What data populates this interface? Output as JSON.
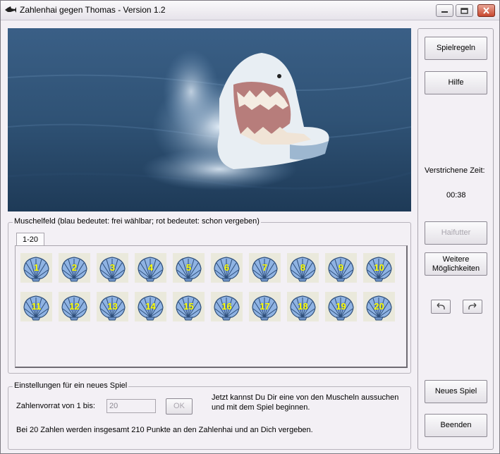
{
  "window": {
    "title": "Zahlenhai gegen Thomas - Version 1.2"
  },
  "shell_field": {
    "legend": "Muschelfeld (blau bedeutet: frei wählbar; rot bedeutet: schon vergeben)",
    "tab": "1-20",
    "shells": [
      "1",
      "2",
      "3",
      "4",
      "5",
      "6",
      "7",
      "8",
      "9",
      "10",
      "11",
      "12",
      "13",
      "14",
      "15",
      "16",
      "17",
      "18",
      "19",
      "20"
    ]
  },
  "new_game_settings": {
    "legend": "Einstellungen für ein neues Spiel",
    "range_label": "Zahlenvorrat von 1 bis:",
    "range_value": "20",
    "ok_label": "OK",
    "hint_line1": "Jetzt kannst Du Dir eine von den Muscheln aussuchen",
    "hint_line2": "und mit dem Spiel beginnen.",
    "info": "Bei 20 Zahlen werden insgesamt 210 Punkte an den Zahlenhai und an Dich vergeben."
  },
  "sidebar": {
    "rules_label": "Spielregeln",
    "help_label": "Hilfe",
    "elapsed_label": "Verstrichene Zeit:",
    "elapsed_value": "00:38",
    "feed_label": "Haifutter",
    "more_label_1": "Weitere",
    "more_label_2": "Möglichkeiten",
    "new_game_label": "Neues Spiel",
    "quit_label": "Beenden"
  },
  "colors": {
    "shell_blue": "#8fb3e3",
    "number_yellow": "#ffff00",
    "window_bg": "#f3f0f5",
    "close_red": "#c8472e"
  },
  "icons": {
    "app": "shark-icon",
    "undo": "undo-icon",
    "redo": "redo-icon"
  }
}
